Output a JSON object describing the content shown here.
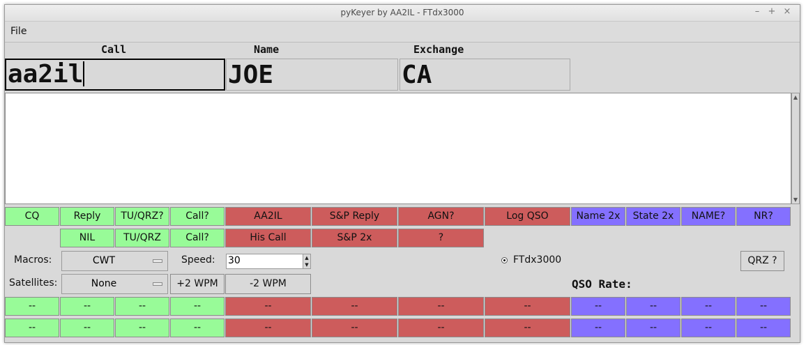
{
  "window": {
    "title": "pyKeyer by AA2IL - FTdx3000",
    "controls": {
      "minimize": "–",
      "maximize": "+",
      "close": "×"
    }
  },
  "menu": {
    "file": "File"
  },
  "fields": {
    "call": {
      "label": "Call",
      "value": "aa2il"
    },
    "name": {
      "label": "Name",
      "value": "JOE"
    },
    "exchange": {
      "label": "Exchange",
      "value": "CA"
    }
  },
  "log_text": "",
  "row1": [
    {
      "label": "CQ",
      "color": "green"
    },
    {
      "label": "Reply",
      "color": "green"
    },
    {
      "label": "TU/QRZ?",
      "color": "green"
    },
    {
      "label": "Call?",
      "color": "green"
    },
    {
      "label": "AA2IL",
      "color": "red"
    },
    {
      "label": "S&P Reply",
      "color": "red"
    },
    {
      "label": "AGN?",
      "color": "red"
    },
    {
      "label": "Log QSO",
      "color": "red"
    },
    {
      "label": "Name 2x",
      "color": "blue"
    },
    {
      "label": "State 2x",
      "color": "blue"
    },
    {
      "label": "NAME?",
      "color": "blue"
    },
    {
      "label": "NR?",
      "color": "blue"
    }
  ],
  "row2": [
    {
      "label": "NIL",
      "color": "green"
    },
    {
      "label": "TU/QRZ",
      "color": "green"
    },
    {
      "label": "Call?",
      "color": "green"
    },
    {
      "label": "His Call",
      "color": "red"
    },
    {
      "label": "S&P 2x",
      "color": "red"
    },
    {
      "label": "?",
      "color": "red"
    }
  ],
  "controls": {
    "macros_label": "Macros:",
    "macros_value": "CWT",
    "speed_label": "Speed:",
    "speed_value": "30",
    "rig_radio": "FTdx3000",
    "qrz_button": "QRZ ?",
    "satellites_label": "Satellites:",
    "satellites_value": "None",
    "plus_wpm": "+2 WPM",
    "minus_wpm": "-2 WPM",
    "qso_rate_label": "QSO Rate:"
  },
  "spot_row1": [
    "--",
    "--",
    "--",
    "--",
    "--",
    "--",
    "--",
    "--",
    "--",
    "--",
    "--",
    "--"
  ],
  "spot_row2": [
    "--",
    "--",
    "--",
    "--",
    "--",
    "--",
    "--",
    "--",
    "--",
    "--",
    "--",
    "--"
  ],
  "colors": {
    "green": "#98fb98",
    "red": "#cd5c5c",
    "blue": "#8470ff",
    "background": "#d9d9d9"
  }
}
